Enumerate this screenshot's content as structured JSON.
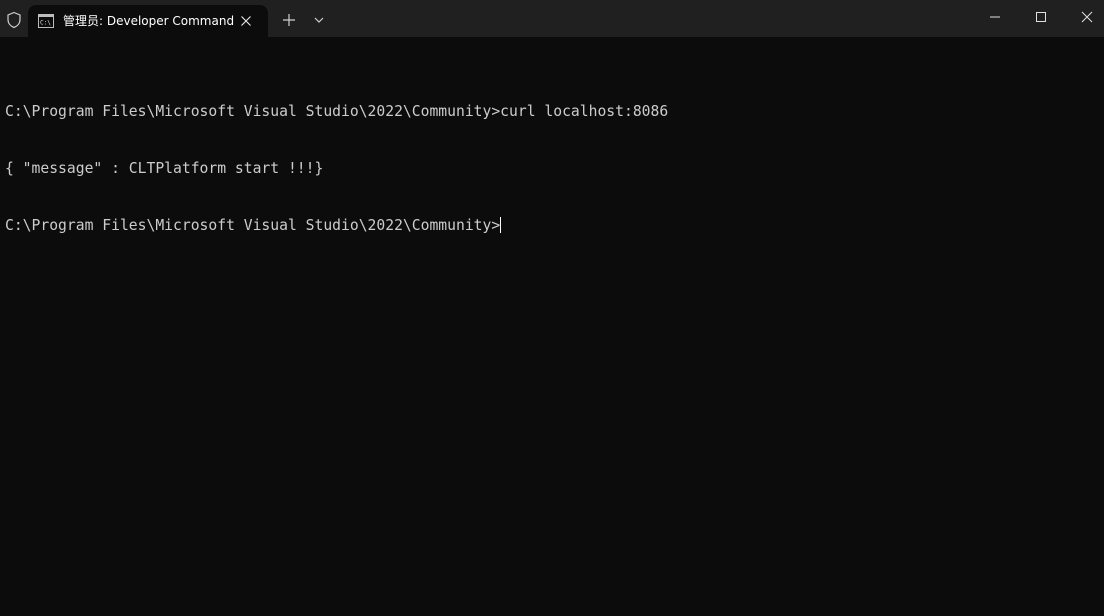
{
  "window": {
    "tab_title": "管理员: Developer Command",
    "icons": {
      "shield": "shield-icon",
      "tab": "cmd-icon",
      "tab_close": "close-icon",
      "new_tab": "plus-icon",
      "dropdown": "chevron-down-icon",
      "minimize": "minimize-icon",
      "maximize": "maximize-icon",
      "close": "close-icon"
    }
  },
  "terminal": {
    "lines": [
      "C:\\Program Files\\Microsoft Visual Studio\\2022\\Community>curl localhost:8086",
      "{ \"message\" : CLTPlatform start !!!}",
      "C:\\Program Files\\Microsoft Visual Studio\\2022\\Community>"
    ]
  },
  "colors": {
    "titlebar": "#202020",
    "background": "#0c0c0c",
    "text": "#cccccc"
  }
}
